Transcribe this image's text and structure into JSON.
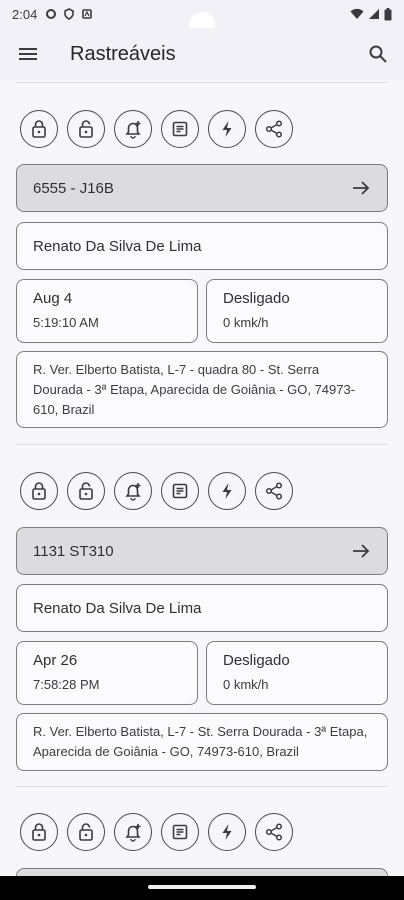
{
  "status": {
    "time": "2:04"
  },
  "appbar": {
    "title": "Rastreáveis"
  },
  "icons": [
    "lock-icon",
    "lock-open-icon",
    "bell-plus-icon",
    "document-icon",
    "bolt-icon",
    "share-icon"
  ],
  "vehicles": [
    {
      "plate": "6555 - J16B",
      "driver": "Renato Da Silva De Lima",
      "date": "Aug 4",
      "time": "5:19:10 AM",
      "status": "Desligado",
      "speed": "0 kmk/h",
      "address": "R. Ver. Elberto Batista, L-7 - quadra 80 - St. Serra Dourada - 3ª Etapa, Aparecida de Goiânia - GO, 74973-610, Brazil"
    },
    {
      "plate": "1131 ST310",
      "driver": "Renato Da Silva De Lima",
      "date": "Apr 26",
      "time": "7:58:28 PM",
      "status": "Desligado",
      "speed": "0 kmk/h",
      "address": "R. Ver. Elberto Batista, L-7 - St. Serra Dourada - 3ª Etapa, Aparecida de Goiânia - GO, 74973-610, Brazil"
    }
  ]
}
